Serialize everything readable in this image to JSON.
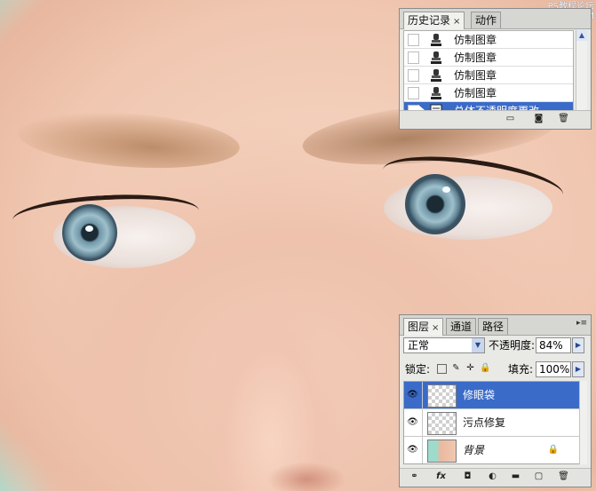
{
  "watermark": "PS教程论坛\nBBS.16XX8.COM",
  "history_panel": {
    "tabs": [
      {
        "label": "历史记录",
        "close": "×"
      },
      {
        "label": "动作"
      }
    ],
    "items": [
      {
        "label": "仿制图章",
        "icon": "clone-stamp-icon"
      },
      {
        "label": "仿制图章",
        "icon": "clone-stamp-icon"
      },
      {
        "label": "仿制图章",
        "icon": "clone-stamp-icon"
      },
      {
        "label": "仿制图章",
        "icon": "clone-stamp-icon"
      },
      {
        "label": "总体不透明度更改",
        "icon": "history-state-icon",
        "selected": true
      }
    ],
    "footer_icons": [
      "new-document-from-state-icon",
      "snapshot-icon",
      "delete-icon"
    ]
  },
  "layers_panel": {
    "tabs": [
      {
        "label": "图层",
        "close": "×"
      },
      {
        "label": "通道"
      },
      {
        "label": "路径"
      }
    ],
    "blend_mode": "正常",
    "opacity_label": "不透明度:",
    "opacity_value": "84%",
    "lock_label": "锁定:",
    "fill_label": "填充:",
    "fill_value": "100%",
    "layers": [
      {
        "name": "修眼袋",
        "selected": true,
        "visible": true
      },
      {
        "name": "污点修复",
        "visible": true
      },
      {
        "name": "背景",
        "visible": true,
        "locked": true
      }
    ],
    "footer_icons": [
      "link-icon",
      "fx-icon",
      "mask-icon",
      "adjustment-icon",
      "group-icon",
      "new-layer-icon",
      "delete-icon"
    ]
  },
  "colors": {
    "selection": "#3a6bc8",
    "panel_bg": "#e9e9e6"
  }
}
